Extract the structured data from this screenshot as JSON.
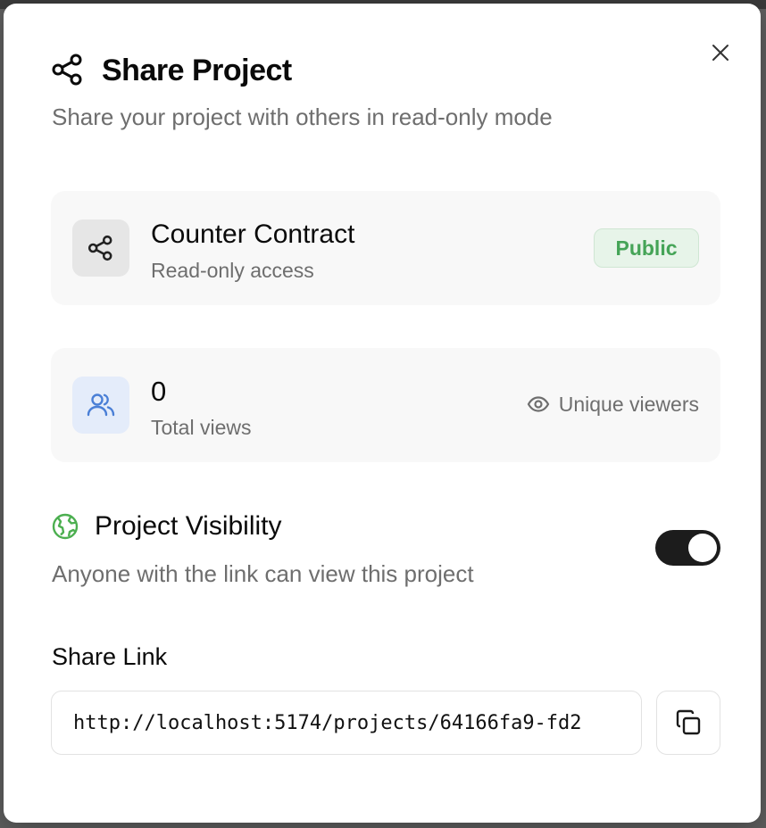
{
  "dialog": {
    "title": "Share Project",
    "subtitle": "Share your project with others in read-only mode",
    "close_icon": "close-icon",
    "header_icon": "share-icon"
  },
  "project": {
    "name": "Counter Contract",
    "access": "Read-only access",
    "badge": "Public",
    "badge_color": "#45a457"
  },
  "views": {
    "count": "0",
    "label": "Total views",
    "unique_label": "Unique viewers"
  },
  "visibility": {
    "title": "Project Visibility",
    "description": "Anyone with the link can view this project",
    "enabled": true,
    "icon": "globe-icon",
    "icon_color": "#4caf50"
  },
  "share_link": {
    "label": "Share Link",
    "value": "http://localhost:5174/projects/64166fa9-fd2",
    "copy_icon": "copy-icon"
  }
}
